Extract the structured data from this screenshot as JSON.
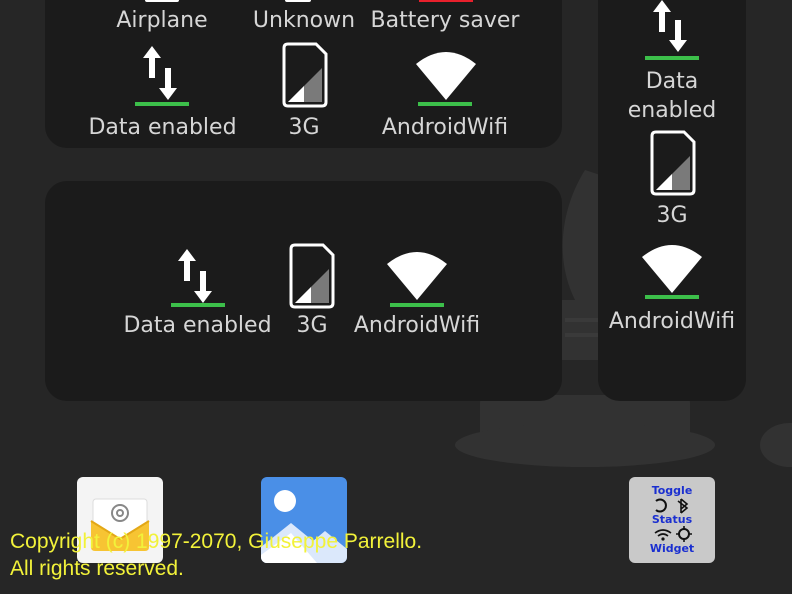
{
  "colors": {
    "background": "#262626",
    "widget": "#1b1b1b",
    "status_bar": "#3cbf4a",
    "battery_saver": "#e8202c",
    "copyright": "#f2f23a"
  },
  "widget_top": {
    "row1": [
      "Airplane",
      "Unknown",
      "Battery saver"
    ],
    "row2": [
      "Data enabled",
      "3G",
      "AndroidWifi"
    ]
  },
  "widget_middle": {
    "items": [
      "Data enabled",
      "3G",
      "AndroidWifi"
    ]
  },
  "widget_right": {
    "data_line1": "Data",
    "data_line2": "enabled",
    "network": "3G",
    "wifi": "AndroidWifi"
  },
  "dock": {
    "apps": [
      {
        "name": "Email",
        "icon": "email-envelope-icon"
      },
      {
        "name": "Gallery",
        "icon": "gallery-photos-icon"
      },
      {
        "name": "Toggle Status Widget",
        "icon": "toggle-status-widget-icon",
        "icon_text": [
          "Toggle",
          "Status",
          "Widget"
        ]
      }
    ]
  },
  "copyright": {
    "line1": "Copyright (c) 1997-2070, Giuseppe Parrello.",
    "line2": "All rights reserved."
  }
}
